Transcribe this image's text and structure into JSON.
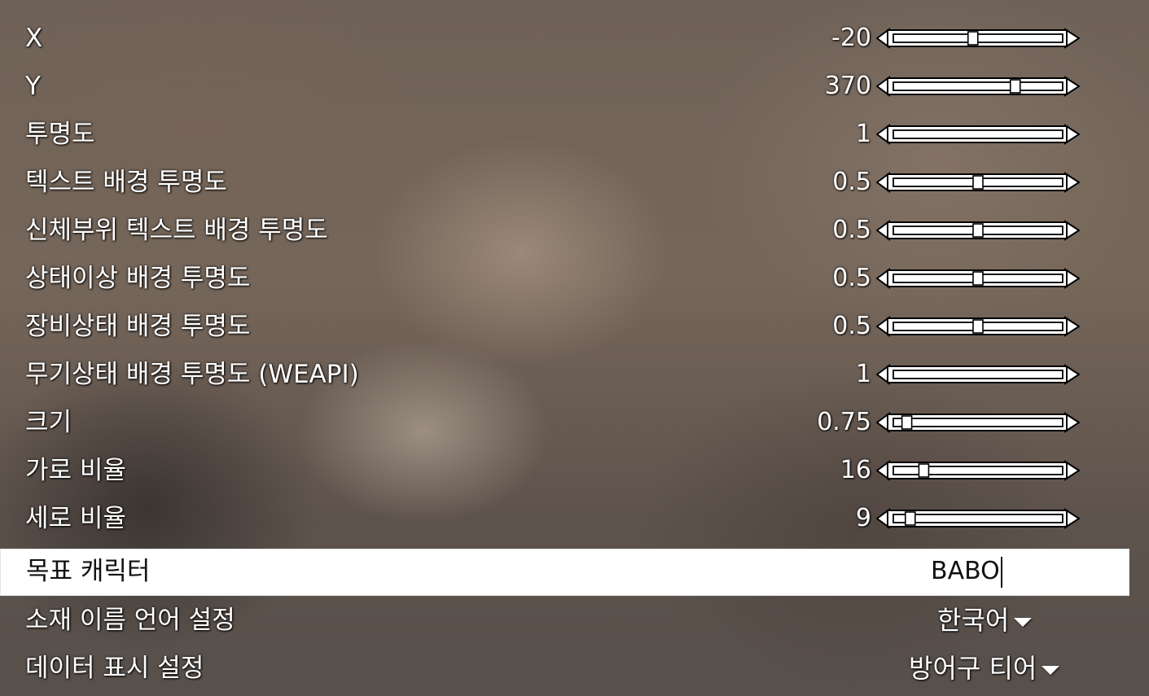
{
  "settings": {
    "sliders": [
      {
        "label": "X",
        "value": "-20",
        "level": 0.47
      },
      {
        "label": "Y",
        "value": "370",
        "level": 0.72
      },
      {
        "label": "투명도",
        "value": "1",
        "level": 1.0
      },
      {
        "label": "텍스트 배경 투명도",
        "value": "0.5",
        "level": 0.5
      },
      {
        "label": "신체부위 텍스트 배경 투명도",
        "value": "0.5",
        "level": 0.5
      },
      {
        "label": "상태이상 배경 투명도",
        "value": "0.5",
        "level": 0.5
      },
      {
        "label": "장비상태 배경 투명도",
        "value": "0.5",
        "level": 0.5
      },
      {
        "label": "무기상태 배경 투명도 (WEAPI)",
        "value": "1",
        "level": 1.0
      },
      {
        "label": "크기",
        "value": "0.75",
        "level": 0.08
      },
      {
        "label": "가로 비율",
        "value": "16",
        "level": 0.18
      },
      {
        "label": "세로 비율",
        "value": "9",
        "level": 0.1
      }
    ],
    "target_character": {
      "label": "목표 캐릭터",
      "value": "BABO"
    },
    "dropdowns": [
      {
        "label": "소재 이름 언어 설정",
        "value": "한국어"
      },
      {
        "label": "데이터 표시 설정",
        "value": "방어구 티어"
      }
    ]
  },
  "colors": {
    "text": "#ffffff",
    "slider_outline": "#000000",
    "selected_row_bg": "#ffffff",
    "selected_row_text": "#111111"
  }
}
